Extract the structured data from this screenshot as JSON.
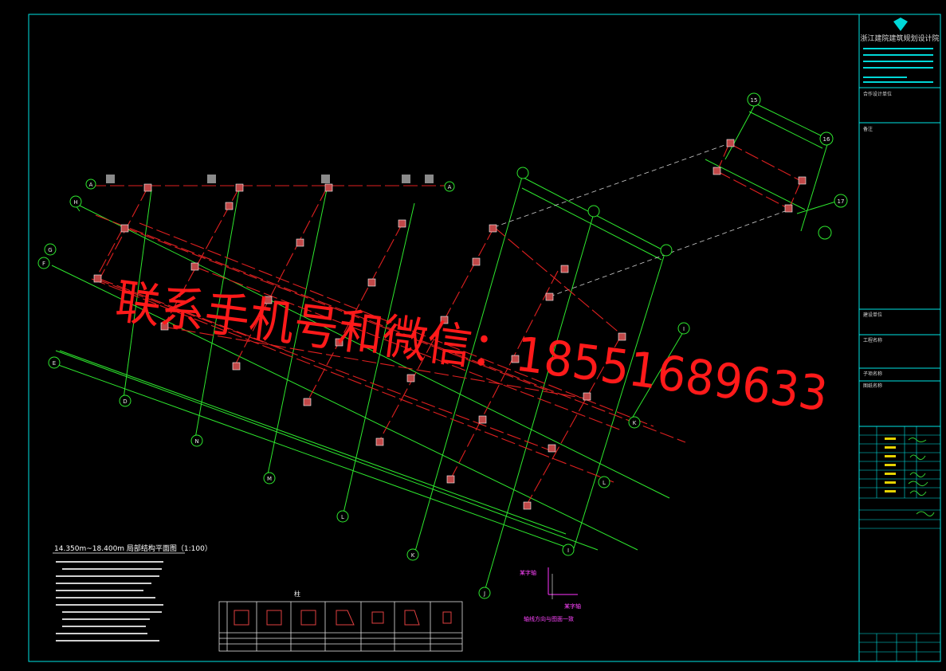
{
  "title_block": {
    "institute": "浙江建院建筑规划设计院",
    "section_labels": [
      "合作设计单位",
      "备注",
      "建设单位",
      "工程名称",
      "子项名称",
      "图纸名称"
    ]
  },
  "plan": {
    "title": "14.350m~18.400m    局部结构平面图（1:100）",
    "row_markers_left": [
      "H",
      "G",
      "F",
      "E",
      "D"
    ],
    "column_markers_top": [
      "A",
      "A"
    ],
    "column_markers_bottom": [
      "N",
      "M",
      "L",
      "K",
      "J",
      "I"
    ],
    "right_markers": [
      "K",
      "L",
      "I",
      "15",
      "16",
      "17"
    ],
    "axis_note_x": "某字轴",
    "axis_note_y": "某字轴",
    "axis_caption": "轴线方向与图面一致",
    "schedule_title": "柱"
  },
  "watermark": {
    "text": "联系手机号和微信：18551689633",
    "color": "#ff1a1a"
  },
  "colors": {
    "background": "#000000",
    "frame": "#00e5e5",
    "grid": "#2ee82e",
    "beam": "#e02020",
    "column": "#d05050",
    "title_block_text": "#d8d8d8"
  }
}
